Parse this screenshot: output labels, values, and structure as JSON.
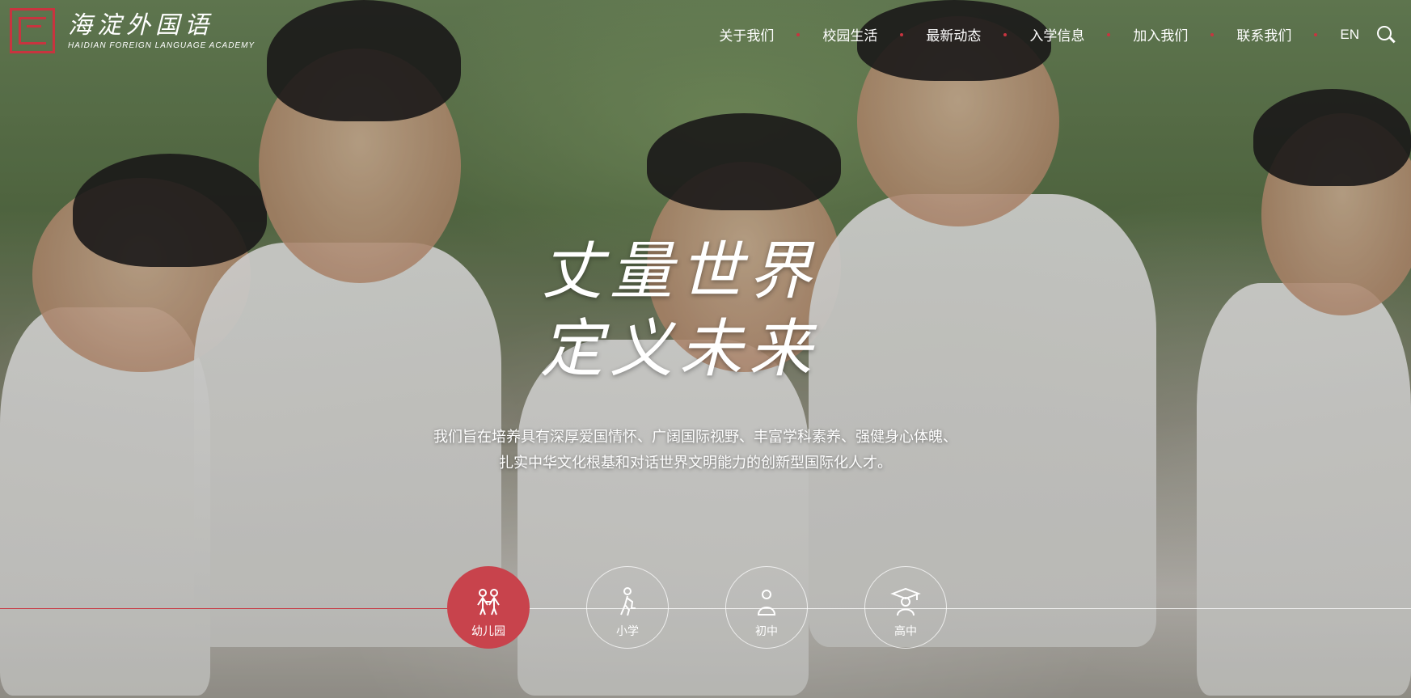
{
  "brand": {
    "name_cn": "海淀外国语",
    "name_en": "HAIDIAN FOREIGN LANGUAGE ACADEMY",
    "accent_color": "#c8343f"
  },
  "nav": {
    "items": [
      "关于我们",
      "校园生活",
      "最新动态",
      "入学信息",
      "加入我们",
      "联系我们",
      "EN"
    ]
  },
  "hero": {
    "headline_line1": "丈量世界",
    "headline_line2": "定义未来",
    "subtext_line1": "我们旨在培养具有深厚爱国情怀、广阔国际视野、丰富学科素养、强健身心体魄、",
    "subtext_line2": "扎实中华文化根基和对话世界文明能力的创新型国际化人才。"
  },
  "stages": [
    {
      "label": "幼儿园",
      "icon": "children-icon",
      "active": true
    },
    {
      "label": "小学",
      "icon": "walking-student-icon",
      "active": false
    },
    {
      "label": "初中",
      "icon": "student-icon",
      "active": false
    },
    {
      "label": "高中",
      "icon": "graduate-cap-icon",
      "active": false
    }
  ]
}
